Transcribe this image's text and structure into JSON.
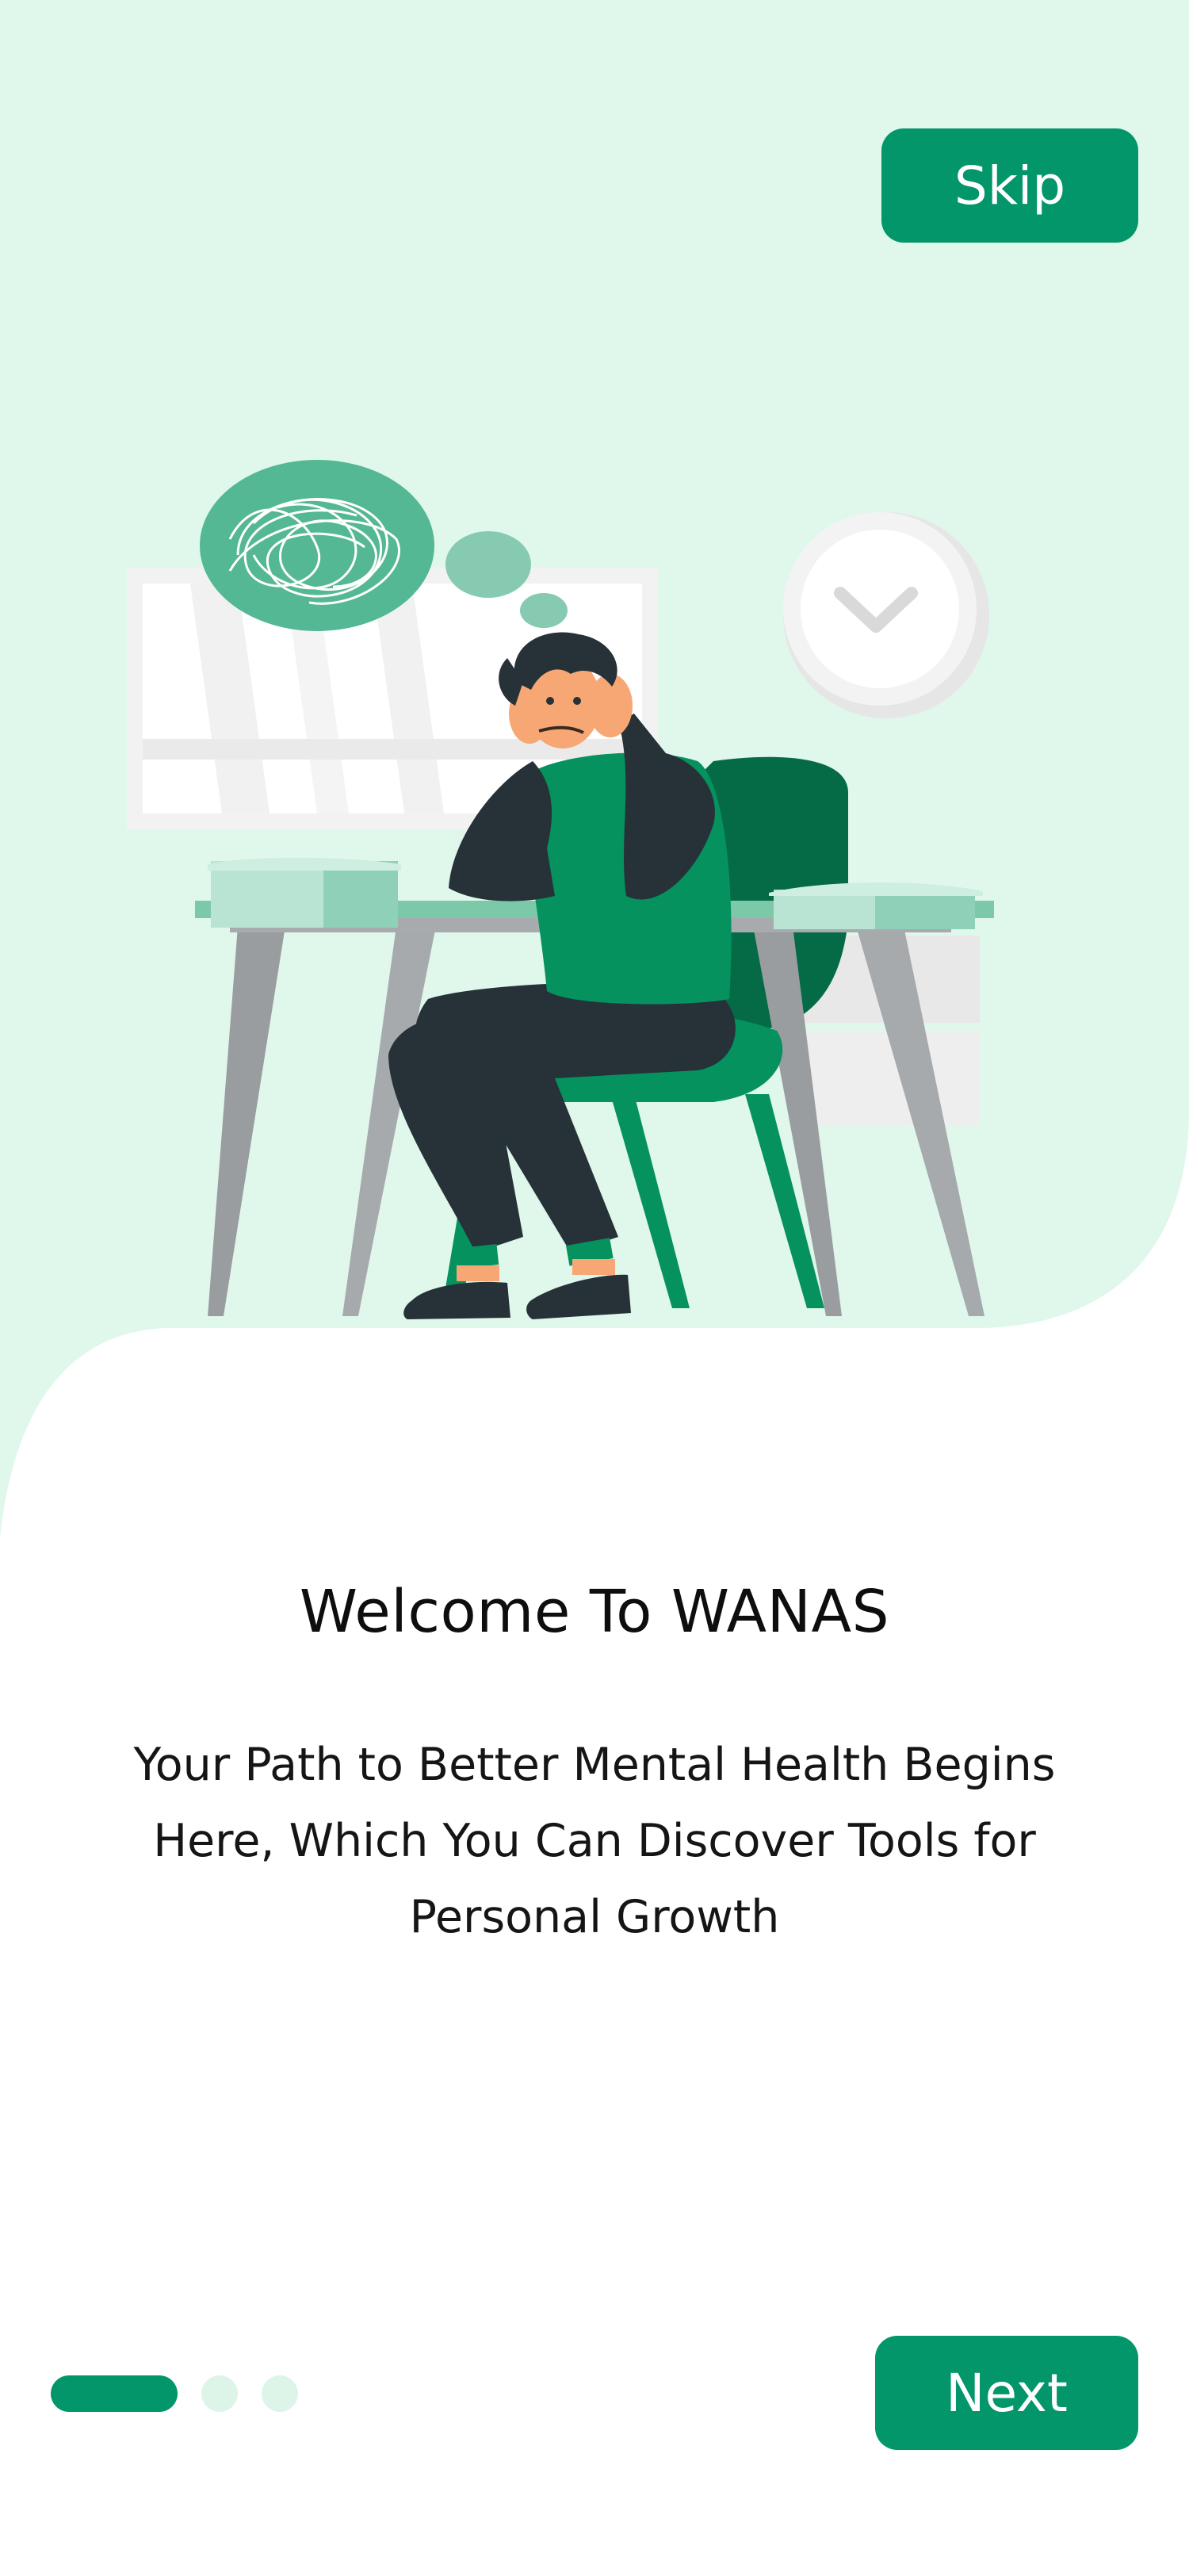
{
  "header": {
    "skip_label": "Skip"
  },
  "onboarding": {
    "title": "Welcome To WANAS",
    "description": "Your Path to Better Mental Health Begins Here, Which You Can Discover Tools for Personal Growth",
    "illustration": "stressed-person-at-desk-illustration"
  },
  "pagination": {
    "current_page": 1,
    "total_pages": 3
  },
  "footer": {
    "next_label": "Next"
  },
  "colors": {
    "primary": "#03966A",
    "background_tint": "#E0F7EC",
    "inactive_dot": "#DDF5E9",
    "text": "#111111"
  }
}
